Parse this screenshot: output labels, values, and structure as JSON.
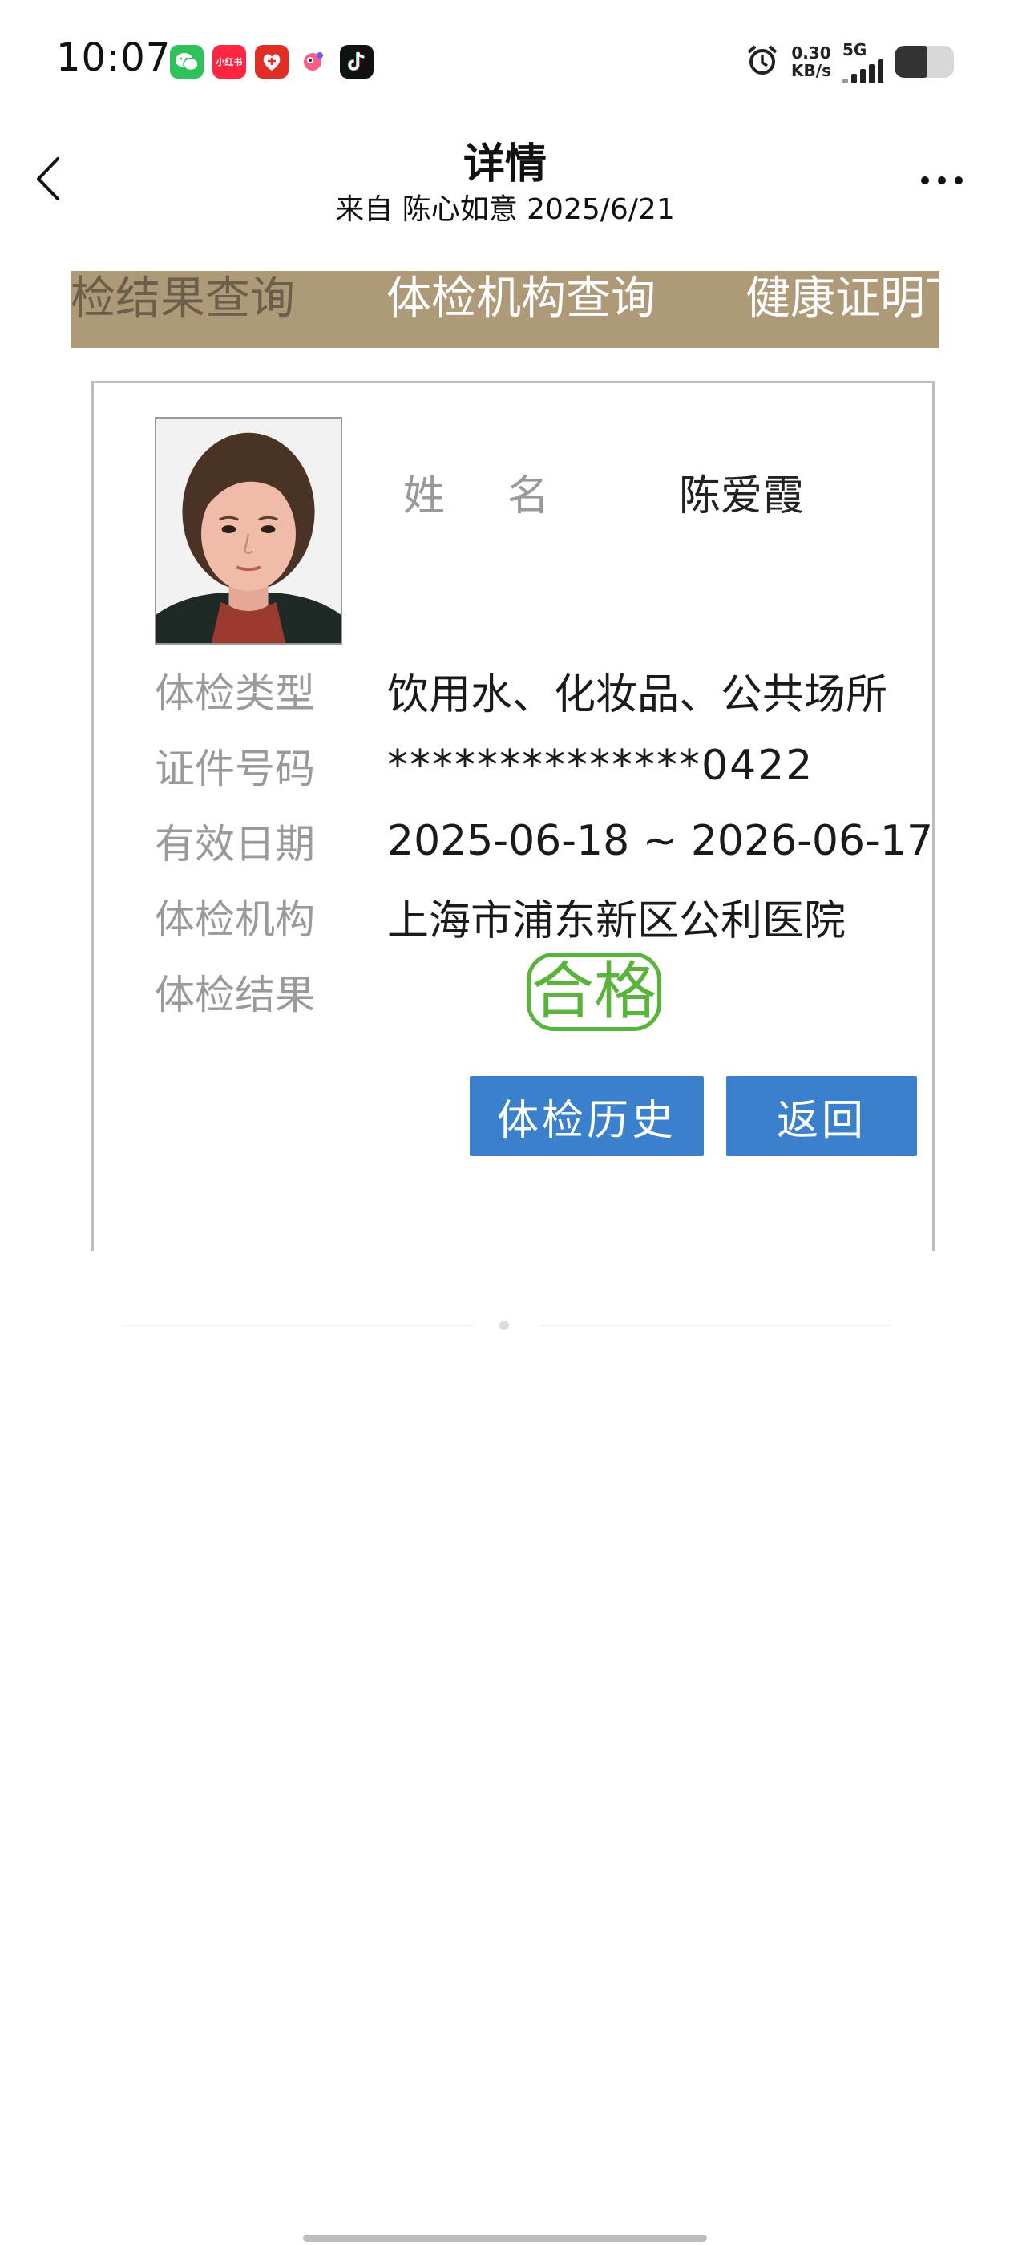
{
  "status_bar": {
    "time": "10:07",
    "apps": [
      {
        "icon": "wechat-icon",
        "label": ""
      },
      {
        "icon": "xiaohongshu-icon",
        "label": "小红书"
      },
      {
        "icon": "pinduoduo-icon",
        "label": ""
      },
      {
        "icon": "cartoon-app-icon",
        "label": ""
      },
      {
        "icon": "tiktok-icon",
        "label": ""
      }
    ],
    "alarm_icon": "alarm-icon",
    "net_speed_value": "0.30",
    "net_speed_unit": "KB/s",
    "network_type": "5G",
    "battery_level": 0.55
  },
  "header": {
    "title": "详情",
    "subtitle": "来自 陈心如意 2025/6/21",
    "back_icon": "chevron-left-icon",
    "more_icon": "more-dots-icon"
  },
  "banner": {
    "items": [
      "检结果查询",
      "体检机构查询",
      "健康证明下"
    ],
    "background": "#ae9a78"
  },
  "card": {
    "photo_alt": "",
    "name_label": "姓名",
    "name_value": "陈爱霞",
    "fields": [
      {
        "label": "体检类型",
        "value": "饮用水、化妆品、公共场所"
      },
      {
        "label": "证件号码",
        "value": "**************0422"
      },
      {
        "label": "有效日期",
        "value": "2025-06-18 ~ 2026-06-17"
      },
      {
        "label": "体检机构",
        "value": "上海市浦东新区公利医院"
      }
    ],
    "result_label": "体检结果",
    "result_stamp": "合格",
    "stamp_color": "#5ab33a",
    "buttons": {
      "history": "体检历史",
      "back": "返回"
    },
    "button_color": "#3b80cc"
  }
}
